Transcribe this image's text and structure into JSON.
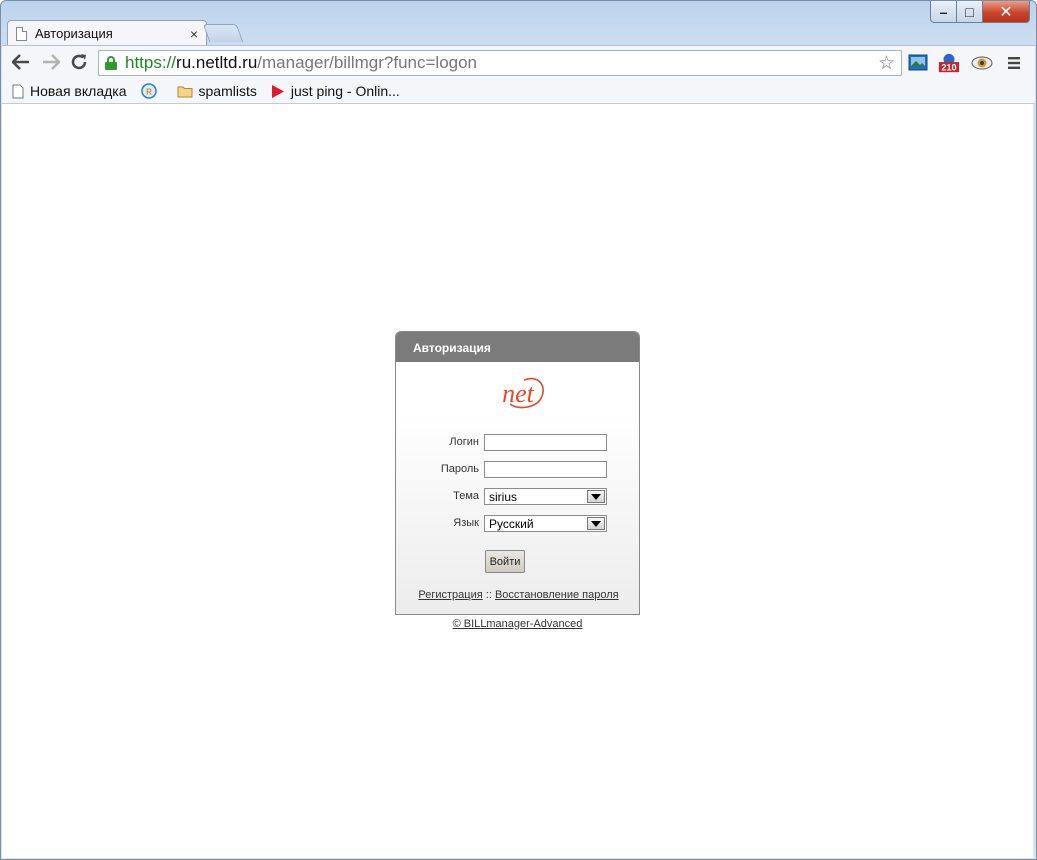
{
  "browser": {
    "tab": {
      "title": "Авторизация",
      "close": "×"
    },
    "window_controls": {
      "minimize": "–",
      "maximize": "□",
      "close": "✕"
    },
    "url": {
      "scheme": "https://",
      "host": "ru.netltd.ru",
      "path": "/manager/billmgr?func=logon"
    },
    "extensions": [
      {
        "name": "picture-extension-icon",
        "badge": ""
      },
      {
        "name": "counter-extension-icon",
        "badge": "210"
      },
      {
        "name": "eye-extension-icon",
        "badge": ""
      }
    ],
    "bookmarks": [
      {
        "label": "Новая вкладка",
        "icon": "page-icon"
      },
      {
        "label": "",
        "icon": "ru-globe-icon"
      },
      {
        "label": "spamlists",
        "icon": "folder-icon"
      },
      {
        "label": "just ping - Onlin...",
        "icon": "red-play-icon"
      }
    ]
  },
  "auth": {
    "title": "Авторизация",
    "logo_text": "net",
    "colors": {
      "header": "#7b7b7b",
      "logo": "#e3482a"
    },
    "login_label": "Логин",
    "login_value": "",
    "password_label": "Пароль",
    "password_value": "",
    "theme_label": "Тема",
    "theme_value": "sirius",
    "language_label": "Язык",
    "language_value": "Русский",
    "submit_label": "Войти",
    "register_link": "Регистрация",
    "link_separator": "::",
    "restore_link": "Восстановление пароля",
    "copyright": "© BILLmanager-Advanced"
  }
}
